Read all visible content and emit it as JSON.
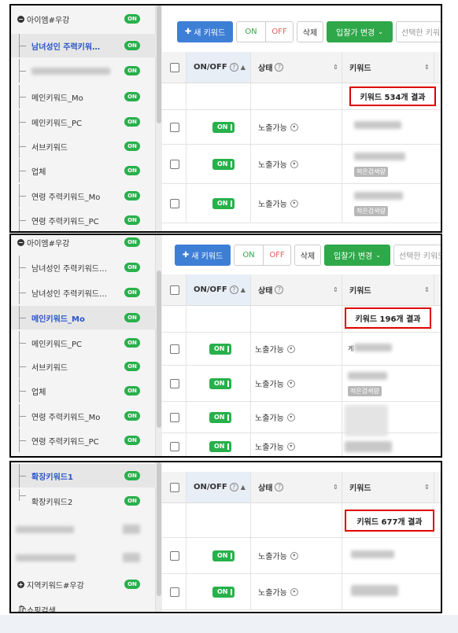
{
  "sidebar": {
    "group_main": "아이엠#우강",
    "group_region": "지역키워드#우강",
    "shopping_search": "쇼핑검색",
    "on_label": "ON",
    "items": {
      "male_female": "남녀성인 주력키워…",
      "male_female_full": "남녀성인 주력키워드…",
      "main_mo": "메인키워드_Mo",
      "main_pc": "메인키워드_PC",
      "sub": "서브키워드",
      "biz": "업체",
      "age_mo": "연령 주력키워드_Mo",
      "age_pc": "연령 주력키워드_PC",
      "ext1": "확장키워드1",
      "ext2": "확장키워드2"
    }
  },
  "toolbar": {
    "new_keyword": "새 키워드",
    "on": "ON",
    "off": "OFF",
    "delete": "삭제",
    "bid_change": "입찰가 변경",
    "selected_keyword": "선택한 키워드"
  },
  "table": {
    "col_onoff": "ON/OFF",
    "col_status": "상태",
    "col_keyword": "키워드",
    "toggle_label": "ON",
    "status_value": "노출가능",
    "tag_low_search": "적은검색량",
    "keyword_partial": "게"
  },
  "results": {
    "panel1": "키워드 534개 결과",
    "panel2": "키워드 196개 결과",
    "panel3": "키워드 677개 결과"
  }
}
